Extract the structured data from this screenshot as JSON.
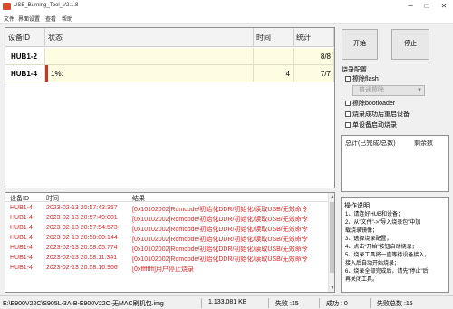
{
  "window": {
    "title": "USB_Burning_Tool_V2.1.8"
  },
  "menu": [
    "文件",
    "界面设置",
    "查看",
    "帮助"
  ],
  "grid": {
    "headers": [
      "设备ID",
      "状态",
      "时间",
      "统计"
    ],
    "rows": [
      {
        "id": "HUB1-2",
        "status": "",
        "time": "",
        "stat": "8/8",
        "active": false
      },
      {
        "id": "HUB1-4",
        "status": "1%:",
        "time": "4",
        "stat": "7/7",
        "active": true
      }
    ]
  },
  "buttons": {
    "start": "开始",
    "stop": "停止"
  },
  "config": {
    "title": "烧录配置",
    "erase_flash": "擦除flash",
    "erase_mode": "普通擦除",
    "erase_bootloader": "擦除bootloader",
    "reset_after": "烧录成功后重启设备",
    "single_auto": "单设备启动烧录"
  },
  "stats_box": {
    "success": "总计(已完成/总数)",
    "remain": "剩余数"
  },
  "log": {
    "headers": [
      "设备ID",
      "时间",
      "结果"
    ],
    "rows": [
      {
        "id": "HUB1-4",
        "time": "2023-02-13 20:57:43:367",
        "result": "[0x10102002]Romcode/初始化DDR/初始化/读取USB/无效命令"
      },
      {
        "id": "HUB1-4",
        "time": "2023-02-13 20:57:49:001",
        "result": "[0x10102002]Romcode/初始化DDR/初始化/读取USB/无效命令"
      },
      {
        "id": "HUB1-4",
        "time": "2023-02-13 20:57:54:573",
        "result": "[0x10102002]Romcode/初始化DDR/初始化/读取USB/无效命令"
      },
      {
        "id": "HUB1-4",
        "time": "2023-02-13 20:58:00:144",
        "result": "[0x10102002]Romcode/初始化DDR/初始化/读取USB/无效命令"
      },
      {
        "id": "HUB1-4",
        "time": "2023-02-13 20:58:05:774",
        "result": "[0x10102002]Romcode/初始化DDR/初始化/读取USB/无效命令"
      },
      {
        "id": "HUB1-4",
        "time": "2023-02-13 20:58:11:341",
        "result": "[0x10102002]Romcode/初始化DDR/初始化/读取USB/无效命令"
      },
      {
        "id": "HUB1-4",
        "time": "2023-02-13 20:58:16:906",
        "result": "[0xffffffff]用户停止烧录"
      }
    ]
  },
  "help": {
    "title": "操作说明",
    "lines": [
      "1、请连好HUB和设备；",
      "2、从\"文件\"->\"导入烧录包\"中加",
      "   载烧录镜像；",
      "3、选择烧录配置；",
      "4、点击\"开始\"按钮启动烧录；",
      "5、烧录工具将一直等待设备接入，",
      "   接入后自动开始烧录；",
      "6、烧录全部完成后，请先\"停止\"后",
      "   再关闭工具。"
    ]
  },
  "statusbar": {
    "path": "E:\\E900V22C\\S905L-3A-B-E900V22C-无MAC刷机包.img",
    "size": "1,133,081 KB",
    "failed": "失败 :15",
    "success": "成功 : 0",
    "total": "失败总数 :15"
  }
}
